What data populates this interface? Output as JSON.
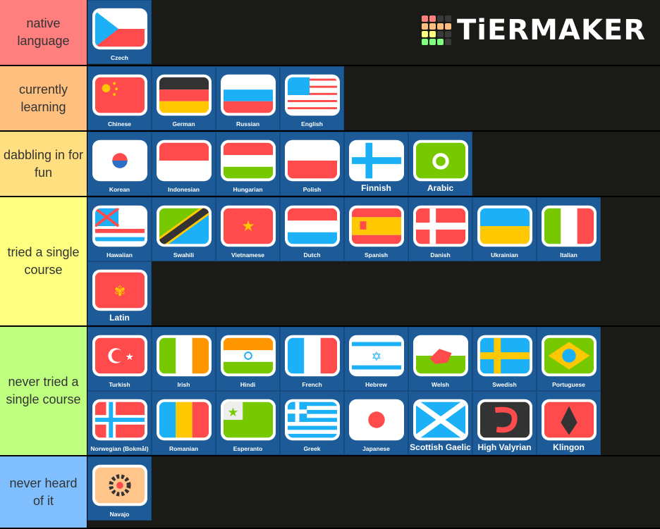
{
  "logo": {
    "text": "TiERMAKER",
    "grid_colors": [
      "#ff7f7f",
      "#ff7f7f",
      "#3a3a3a",
      "#3a3a3a",
      "#ffbf7f",
      "#ffbf7f",
      "#ffbf7f",
      "#ffbf7f",
      "#ffff7f",
      "#ffff7f",
      "#3a3a3a",
      "#3a3a3a",
      "#7fff7f",
      "#7fff7f",
      "#7fff7f",
      "#3a3a3a"
    ]
  },
  "tiers": [
    {
      "label": "native language",
      "color": "#ff7f7f",
      "items": [
        {
          "name": "Czech",
          "flag": "czech"
        }
      ]
    },
    {
      "label": "currently learning",
      "color": "#ffbf7f",
      "items": [
        {
          "name": "Chinese",
          "flag": "chinese"
        },
        {
          "name": "German",
          "flag": "german"
        },
        {
          "name": "Russian",
          "flag": "russian"
        },
        {
          "name": "English",
          "flag": "english"
        }
      ]
    },
    {
      "label": "dabbling in for fun",
      "color": "#ffdf7f",
      "items": [
        {
          "name": "Korean",
          "flag": "korean"
        },
        {
          "name": "Indonesian",
          "flag": "indonesian"
        },
        {
          "name": "Hungarian",
          "flag": "hungarian"
        },
        {
          "name": "Polish",
          "flag": "polish"
        },
        {
          "name": "Finnish",
          "flag": "finnish",
          "big": true
        },
        {
          "name": "Arabic",
          "flag": "arabic",
          "big": true
        }
      ]
    },
    {
      "label": "tried a single course",
      "color": "#ffff7f",
      "items": [
        {
          "name": "Hawaiian",
          "flag": "hawaiian"
        },
        {
          "name": "Swahili",
          "flag": "swahili"
        },
        {
          "name": "Vietnamese",
          "flag": "vietnamese"
        },
        {
          "name": "Dutch",
          "flag": "dutch"
        },
        {
          "name": "Spanish",
          "flag": "spanish"
        },
        {
          "name": "Danish",
          "flag": "danish"
        },
        {
          "name": "Ukrainian",
          "flag": "ukrainian"
        },
        {
          "name": "Italian",
          "flag": "italian"
        },
        {
          "name": "Latin",
          "flag": "latin",
          "big": true
        }
      ]
    },
    {
      "label": "never tried a single course",
      "color": "#bfff7f",
      "items": [
        {
          "name": "Turkish",
          "flag": "turkish"
        },
        {
          "name": "Irish",
          "flag": "irish"
        },
        {
          "name": "Hindi",
          "flag": "hindi"
        },
        {
          "name": "French",
          "flag": "french"
        },
        {
          "name": "Hebrew",
          "flag": "hebrew"
        },
        {
          "name": "Welsh",
          "flag": "welsh"
        },
        {
          "name": "Swedish",
          "flag": "swedish"
        },
        {
          "name": "Portuguese",
          "flag": "portuguese"
        },
        {
          "name": "Norwegian (Bokmål)",
          "flag": "norwegian"
        },
        {
          "name": "Romanian",
          "flag": "romanian"
        },
        {
          "name": "Esperanto",
          "flag": "esperanto"
        },
        {
          "name": "Greek",
          "flag": "greek"
        },
        {
          "name": "Japanese",
          "flag": "japanese"
        },
        {
          "name": "Scottish Gaelic",
          "flag": "scottish",
          "big": true
        },
        {
          "name": "High Valyrian",
          "flag": "valyrian",
          "big": true
        },
        {
          "name": "Klingon",
          "flag": "klingon",
          "big": true
        }
      ]
    },
    {
      "label": "never heard of it",
      "color": "#7fbfff",
      "items": [
        {
          "name": "Navajo",
          "flag": "navajo"
        }
      ]
    }
  ]
}
